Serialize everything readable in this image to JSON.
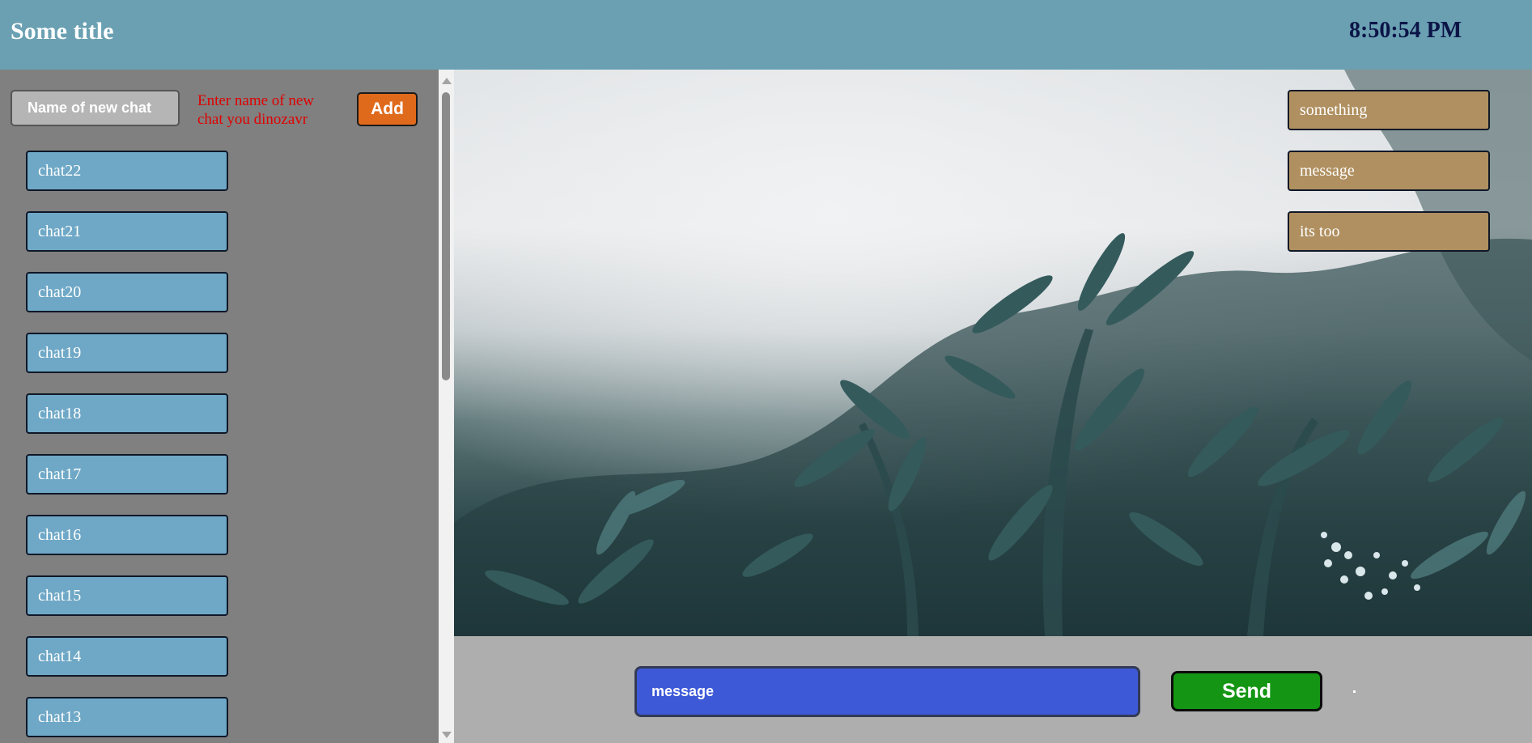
{
  "header": {
    "title": "Some title",
    "clock": "8:50:54 PM"
  },
  "sidebar": {
    "new_chat_placeholder": "Name of new chat",
    "hint": "Enter name of new chat you dinozavr",
    "add_label": "Add",
    "chats": [
      "chat22",
      "chat21",
      "chat20",
      "chat19",
      "chat18",
      "chat17",
      "chat16",
      "chat15",
      "chat14",
      "chat13"
    ]
  },
  "messages": [
    "something",
    "message",
    "its too"
  ],
  "composer": {
    "input_value": "message",
    "send_label": "Send"
  },
  "colors": {
    "header_bg": "#6aa0b2",
    "sidebar_bg": "#808080",
    "chat_item_bg": "#6fa8c6",
    "message_bg": "#b09060",
    "add_button": "#e06a1b",
    "send_button": "#149614",
    "message_input": "#3d59d8",
    "hint_text": "#e00000",
    "clock_text": "#0c1447"
  }
}
